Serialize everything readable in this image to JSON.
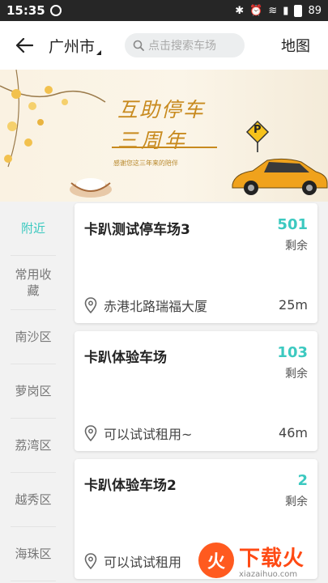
{
  "status": {
    "time": "15:35",
    "battery": "89"
  },
  "header": {
    "city": "广州市",
    "search_placeholder": "点击搜索车场",
    "map_label": "地图"
  },
  "banner": {
    "title_line1": "互助停车",
    "title_line2": "三周年",
    "subtitle": "感谢您这三年来的陪伴",
    "badge": "P"
  },
  "sidebar": {
    "items": [
      "附近",
      "常用收藏",
      "南沙区",
      "萝岗区",
      "荔湾区",
      "越秀区",
      "海珠区"
    ]
  },
  "parking_lots": [
    {
      "name": "卡趴测试停车场3",
      "count": "501",
      "remain_label": "剩余",
      "address": "赤港北路瑞福大厦",
      "distance": "25m"
    },
    {
      "name": "卡趴体验车场",
      "count": "103",
      "remain_label": "剩余",
      "address": "可以试试租用~",
      "distance": "46m"
    },
    {
      "name": "卡趴体验车场2",
      "count": "2",
      "remain_label": "剩余",
      "address": "可以试试租用",
      "distance": ""
    }
  ],
  "watermark": {
    "logo_glyph": "火",
    "brand": "下载火",
    "domain": "xiazaihuo.com"
  },
  "colors": {
    "accent": "#3cc9c0",
    "banner_gold": "#c88a1e",
    "watermark": "#ff4a14"
  }
}
